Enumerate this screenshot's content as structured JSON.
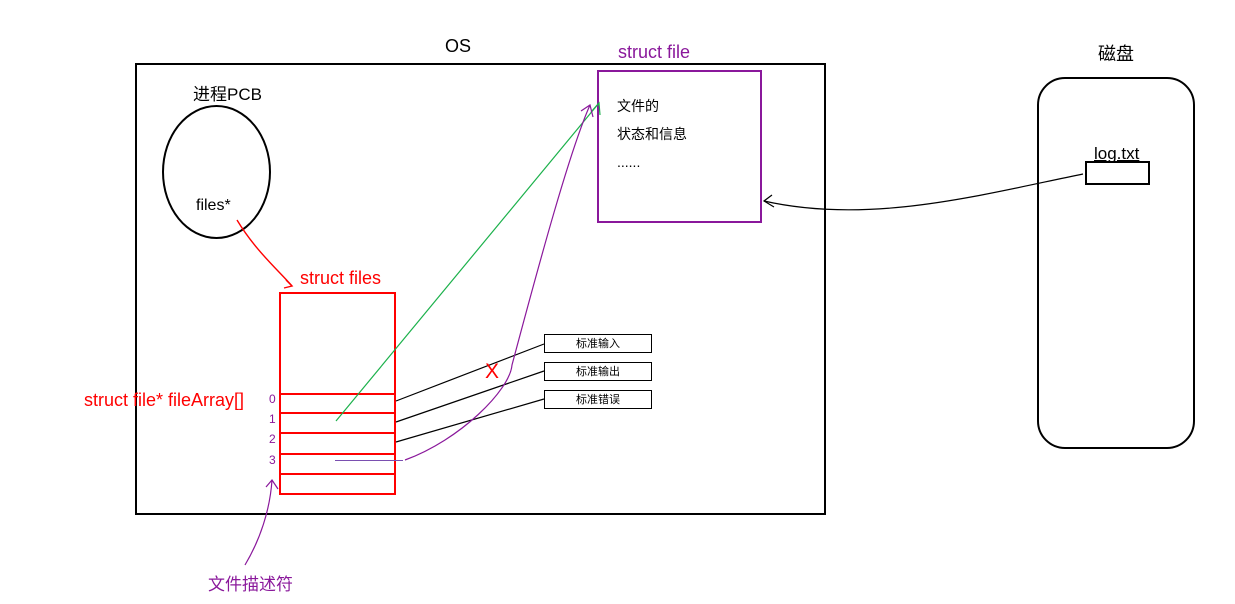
{
  "os_title": "OS",
  "struct_file_label": "struct file",
  "struct_file_content_l1": "文件的",
  "struct_file_content_l2": "状态和信息",
  "struct_file_content_l3": "......",
  "pcb_label": "进程PCB",
  "files_ptr": "files*",
  "struct_files_label": "struct files",
  "file_array_label": "struct file* fileArray[]",
  "indices": {
    "i0": "0",
    "i1": "1",
    "i2": "2",
    "i3": "3"
  },
  "std": {
    "in": "标准输入",
    "out": "标准输出",
    "err": "标准错误"
  },
  "fd_label": "文件描述符",
  "disk_label": "磁盘",
  "logtxt": "log.txt",
  "x_mark": "X"
}
